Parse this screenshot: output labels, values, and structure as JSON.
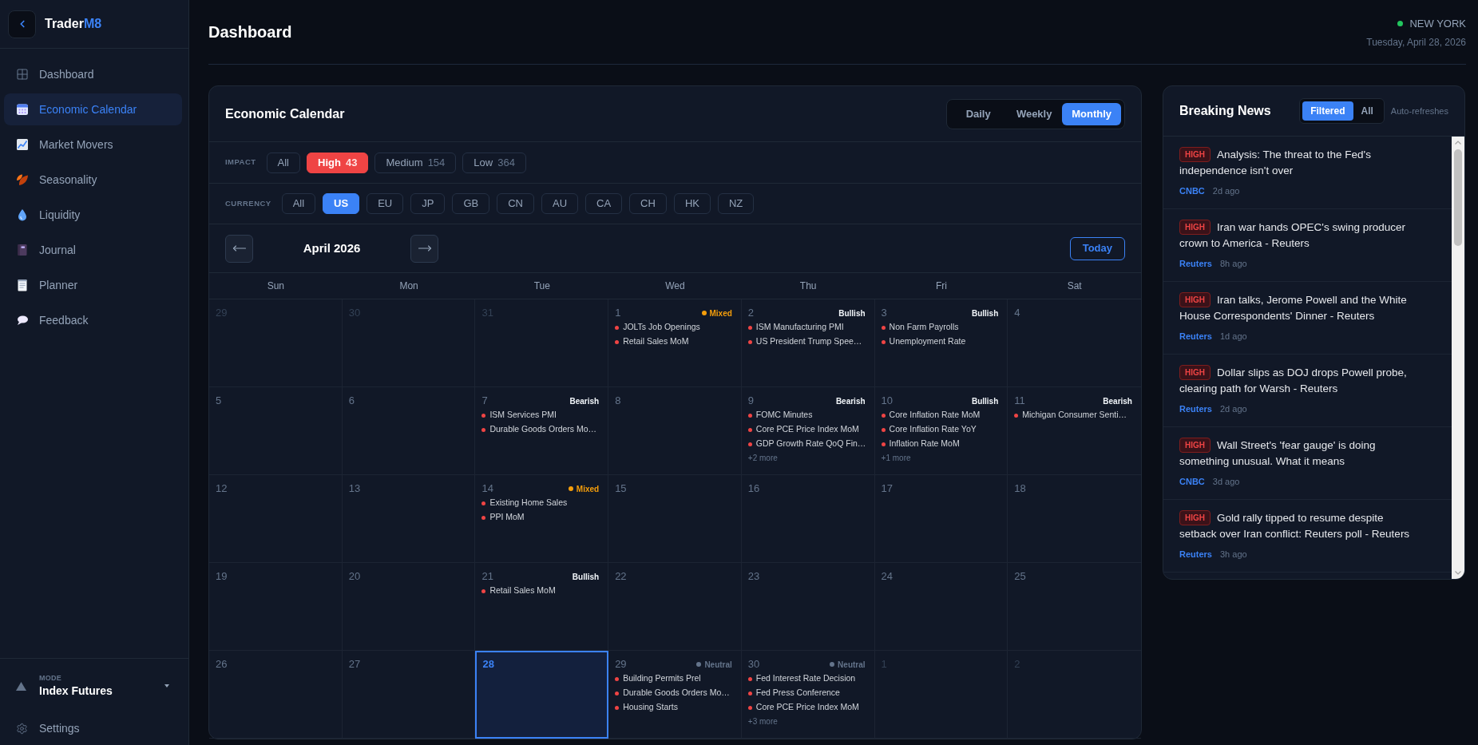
{
  "sidebar": {
    "brand": {
      "name": "Trader",
      "accent": "M8"
    },
    "items": [
      {
        "label": "Dashboard",
        "selected": false
      },
      {
        "label": "Economic Calendar",
        "selected": true
      },
      {
        "label": "Market Movers",
        "selected": false
      },
      {
        "label": "Seasonality",
        "selected": false
      },
      {
        "label": "Liquidity",
        "selected": false
      },
      {
        "label": "Journal",
        "selected": false
      },
      {
        "label": "Planner",
        "selected": false
      },
      {
        "label": "Feedback",
        "selected": false
      }
    ],
    "mode": {
      "label": "MODE",
      "value": "Index Futures"
    },
    "settings": "Settings"
  },
  "header": {
    "title": "Dashboard",
    "market": {
      "city": "NEW YORK",
      "live": true
    },
    "date": "Tuesday, April 28, 2026"
  },
  "calendar": {
    "title": "Economic Calendar",
    "views": [
      {
        "label": "Daily",
        "selected": false
      },
      {
        "label": "Weekly",
        "selected": false
      },
      {
        "label": "Monthly",
        "selected": true
      }
    ],
    "impact": {
      "label": "IMPACT",
      "options": [
        {
          "label": "All",
          "selected": false
        },
        {
          "label": "High",
          "count": "43",
          "selected": true
        },
        {
          "label": "Medium",
          "count": "154",
          "selected": false
        },
        {
          "label": "Low",
          "count": "364",
          "selected": false
        }
      ]
    },
    "currency": {
      "label": "CURRENCY",
      "options": [
        {
          "label": "All",
          "selected": false
        },
        {
          "label": "US",
          "selected": true
        },
        {
          "label": "EU",
          "selected": false
        },
        {
          "label": "JP",
          "selected": false
        },
        {
          "label": "GB",
          "selected": false
        },
        {
          "label": "CN",
          "selected": false
        },
        {
          "label": "AU",
          "selected": false
        },
        {
          "label": "CA",
          "selected": false
        },
        {
          "label": "CH",
          "selected": false
        },
        {
          "label": "HK",
          "selected": false
        },
        {
          "label": "NZ",
          "selected": false
        }
      ]
    },
    "month": "April 2026",
    "today_button": "Today",
    "weekdays": [
      "Sun",
      "Mon",
      "Tue",
      "Wed",
      "Thu",
      "Fri",
      "Sat"
    ],
    "weeks": [
      [
        {
          "day": "29",
          "in_month": false,
          "today": false
        },
        {
          "day": "30",
          "in_month": false,
          "today": false
        },
        {
          "day": "31",
          "in_month": false,
          "today": false
        },
        {
          "day": "1",
          "in_month": true,
          "today": false,
          "sentiment": {
            "label": "Mixed",
            "kind": "mixed"
          },
          "events": [
            "JOLTs Job Openings",
            "Retail Sales MoM"
          ]
        },
        {
          "day": "2",
          "in_month": true,
          "today": false,
          "sentiment": {
            "label": "Bullish",
            "kind": "bullish"
          },
          "events": [
            "ISM Manufacturing PMI",
            "US President Trump Spee…"
          ]
        },
        {
          "day": "3",
          "in_month": true,
          "today": false,
          "sentiment": {
            "label": "Bullish",
            "kind": "bullish"
          },
          "events": [
            "Non Farm Payrolls",
            "Unemployment Rate"
          ]
        },
        {
          "day": "4",
          "in_month": true,
          "today": false
        }
      ],
      [
        {
          "day": "5",
          "in_month": true,
          "today": false
        },
        {
          "day": "6",
          "in_month": true,
          "today": false
        },
        {
          "day": "7",
          "in_month": true,
          "today": false,
          "sentiment": {
            "label": "Bearish",
            "kind": "bearish"
          },
          "events": [
            "ISM Services PMI",
            "Durable Goods Orders Mo…"
          ]
        },
        {
          "day": "8",
          "in_month": true,
          "today": false
        },
        {
          "day": "9",
          "in_month": true,
          "today": false,
          "sentiment": {
            "label": "Bearish",
            "kind": "bearish"
          },
          "events": [
            "FOMC Minutes",
            "Core PCE Price Index MoM",
            "GDP Growth Rate QoQ Fin…"
          ],
          "more": "+2 more"
        },
        {
          "day": "10",
          "in_month": true,
          "today": false,
          "sentiment": {
            "label": "Bullish",
            "kind": "bullish"
          },
          "events": [
            "Core Inflation Rate MoM",
            "Core Inflation Rate YoY",
            "Inflation Rate MoM"
          ],
          "more": "+1 more"
        },
        {
          "day": "11",
          "in_month": true,
          "today": false,
          "sentiment": {
            "label": "Bearish",
            "kind": "bearish"
          },
          "events": [
            "Michigan Consumer Senti…"
          ]
        }
      ],
      [
        {
          "day": "12",
          "in_month": true,
          "today": false
        },
        {
          "day": "13",
          "in_month": true,
          "today": false
        },
        {
          "day": "14",
          "in_month": true,
          "today": false,
          "sentiment": {
            "label": "Mixed",
            "kind": "mixed"
          },
          "events": [
            "Existing Home Sales",
            "PPI MoM"
          ]
        },
        {
          "day": "15",
          "in_month": true,
          "today": false
        },
        {
          "day": "16",
          "in_month": true,
          "today": false
        },
        {
          "day": "17",
          "in_month": true,
          "today": false
        },
        {
          "day": "18",
          "in_month": true,
          "today": false
        }
      ],
      [
        {
          "day": "19",
          "in_month": true,
          "today": false
        },
        {
          "day": "20",
          "in_month": true,
          "today": false
        },
        {
          "day": "21",
          "in_month": true,
          "today": false,
          "sentiment": {
            "label": "Bullish",
            "kind": "bullish"
          },
          "events": [
            "Retail Sales MoM"
          ]
        },
        {
          "day": "22",
          "in_month": true,
          "today": false
        },
        {
          "day": "23",
          "in_month": true,
          "today": false
        },
        {
          "day": "24",
          "in_month": true,
          "today": false
        },
        {
          "day": "25",
          "in_month": true,
          "today": false
        }
      ],
      [
        {
          "day": "26",
          "in_month": true,
          "today": false
        },
        {
          "day": "27",
          "in_month": true,
          "today": false
        },
        {
          "day": "28",
          "in_month": true,
          "today": true
        },
        {
          "day": "29",
          "in_month": true,
          "today": false,
          "sentiment": {
            "label": "Neutral",
            "kind": "neutral"
          },
          "events": [
            "Building Permits Prel",
            "Durable Goods Orders Mo…",
            "Housing Starts"
          ]
        },
        {
          "day": "30",
          "in_month": true,
          "today": false,
          "sentiment": {
            "label": "Neutral",
            "kind": "neutral"
          },
          "events": [
            "Fed Interest Rate Decision",
            "Fed Press Conference",
            "Core PCE Price Index MoM"
          ],
          "more": "+3 more"
        },
        {
          "day": "1",
          "in_month": false,
          "today": false
        },
        {
          "day": "2",
          "in_month": false,
          "today": false
        }
      ]
    ]
  },
  "news": {
    "title": "Breaking News",
    "filters": [
      {
        "label": "Filtered",
        "selected": true
      },
      {
        "label": "All",
        "selected": false
      }
    ],
    "note": "Auto-refreshes",
    "items": [
      {
        "impact": "HIGH",
        "headline": "Analysis: The threat to the Fed's independence isn't over",
        "source": "CNBC",
        "time": "2d ago"
      },
      {
        "impact": "HIGH",
        "headline": "Iran war hands OPEC's swing producer crown to America - Reuters",
        "source": "Reuters",
        "time": "8h ago"
      },
      {
        "impact": "HIGH",
        "headline": "Iran talks, Jerome Powell and the White House Correspondents' Dinner - Reuters",
        "source": "Reuters",
        "time": "1d ago"
      },
      {
        "impact": "HIGH",
        "headline": "Dollar slips as DOJ drops Powell probe, clearing path for Warsh - Reuters",
        "source": "Reuters",
        "time": "2d ago"
      },
      {
        "impact": "HIGH",
        "headline": "Wall Street's 'fear gauge' is doing something unusual. What it means",
        "source": "CNBC",
        "time": "3d ago"
      },
      {
        "impact": "HIGH",
        "headline": "Gold rally tipped to resume despite setback over Iran conflict: Reuters poll - Reuters",
        "source": "Reuters",
        "time": "3h ago"
      }
    ]
  }
}
